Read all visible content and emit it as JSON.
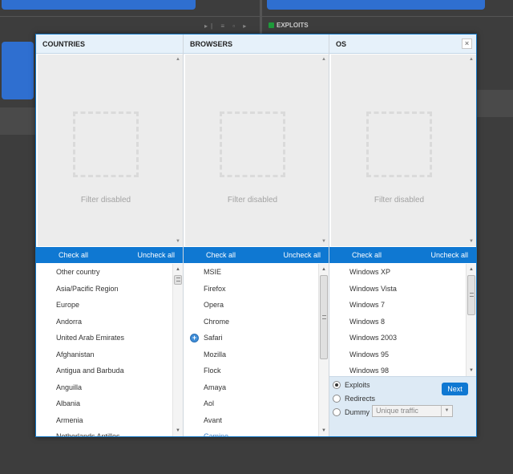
{
  "background": {
    "exploits_label": "EXPLOITS"
  },
  "modal": {
    "close_glyph": "×",
    "filter_disabled": "Filter disabled",
    "check_all": "Check all",
    "uncheck_all": "Uncheck all",
    "columns": {
      "countries": {
        "title": "COUNTRIES",
        "items": [
          "Other country",
          "Asia/Pacific Region",
          "Europe",
          "Andorra",
          "United Arab Emirates",
          "Afghanistan",
          "Antigua and Barbuda",
          "Anguilla",
          "Albania",
          "Armenia",
          "Netherlands Antilles"
        ]
      },
      "browsers": {
        "title": "BROWSERS",
        "items": [
          "MSIE",
          "Firefox",
          "Opera",
          "Chrome",
          "Safari",
          "Mozilla",
          "Flock",
          "Amaya",
          "Aol",
          "Avant",
          "Camino"
        ]
      },
      "os": {
        "title": "OS",
        "items": [
          "Windows XP",
          "Windows Vista",
          "Windows 7",
          "Windows 8",
          "Windows 2003",
          "Windows 95",
          "Windows 98"
        ]
      }
    },
    "options": {
      "exploits": "Exploits",
      "redirects": "Redirects",
      "dummy": "Dummy",
      "selected": "exploits",
      "traffic_select_value": "Unique traffic",
      "next_label": "Next"
    }
  }
}
